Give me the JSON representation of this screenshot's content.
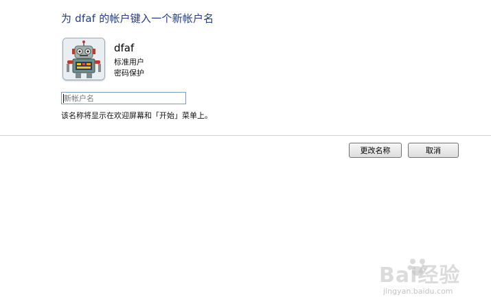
{
  "dialog": {
    "heading": "为 dfaf 的帐户键入一个新帐户名",
    "account": {
      "name": "dfaf",
      "type": "标准用户",
      "protection": "密码保护",
      "avatar_icon": "robot-icon"
    },
    "new_name_input": {
      "value": "",
      "placeholder": "新帐户名"
    },
    "hint": "该名称将显示在欢迎屏幕和「开始」菜单上。",
    "buttons": {
      "rename_label": "更改名称",
      "cancel_label": "取消"
    }
  },
  "watermark": {
    "text": "Bai经验",
    "subtext": "jingyan.baidu.com"
  },
  "colors": {
    "heading": "#1e3b8f",
    "input_border": "#7a9bc4",
    "divider": "#d3d3d3"
  }
}
